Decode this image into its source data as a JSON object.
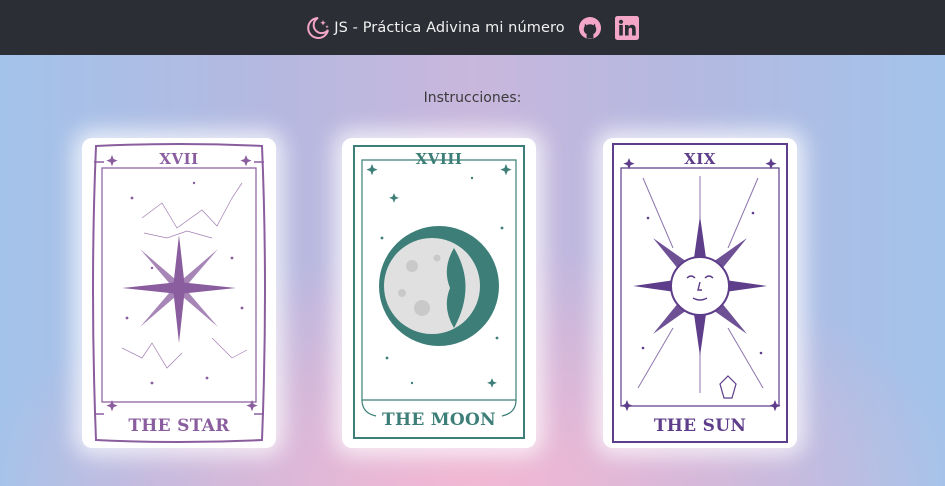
{
  "header": {
    "title": "JS - Práctica Adivina mi número",
    "logo_icon": "moon-stars-icon",
    "social": [
      {
        "name": "github-icon",
        "color": "#f4a6c7"
      },
      {
        "name": "linkedin-icon",
        "color": "#f4a6c7"
      }
    ]
  },
  "instructions": "Instrucciones:",
  "cards": [
    {
      "numeral": "XVII",
      "name": "THE STAR",
      "color": "#8a5d9f"
    },
    {
      "numeral": "XVIII",
      "name": "THE MOON",
      "color": "#3d7f78"
    },
    {
      "numeral": "XIX",
      "name": "THE SUN",
      "color": "#5e3d8a"
    }
  ]
}
